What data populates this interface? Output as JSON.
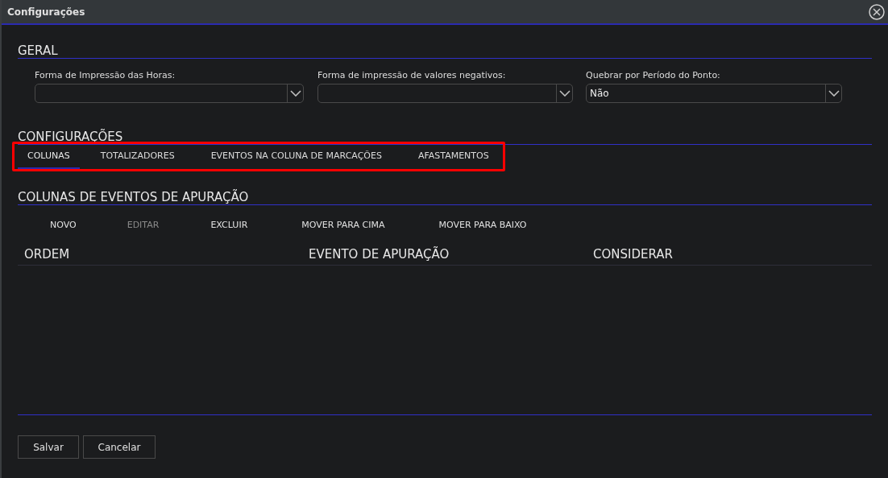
{
  "window": {
    "title": "Configurações"
  },
  "sections": [
    {
      "title": "GERAL"
    },
    {
      "title": "CONFIGURAÇÕES"
    },
    {
      "title": "COLUNAS DE EVENTOS DE APURAÇÃO"
    }
  ],
  "fields": [
    {
      "label": "Forma de Impressão das Horas:"
    },
    {
      "label": "Forma de impressão de valores negativos:"
    },
    {
      "label": "Quebrar por Período do Ponto:",
      "value": "Não"
    }
  ],
  "tabs": [
    {
      "label": "COLUNAS",
      "selected": true
    },
    {
      "label": "TOTALIZADORES",
      "selected": false
    },
    {
      "label": "EVENTOS NA COLUNA DE MARCAÇÕES",
      "selected": false
    },
    {
      "label": "AFASTAMENTOS",
      "selected": false
    }
  ],
  "tabs_highlighted": true,
  "toolbar": [
    {
      "label": "NOVO",
      "disabled": false
    },
    {
      "label": "EDITAR",
      "disabled": true
    },
    {
      "label": "EXCLUIR",
      "disabled": false
    },
    {
      "label": "MOVER PARA CIMA",
      "disabled": false
    },
    {
      "label": "MOVER PARA BAIXO",
      "disabled": false
    }
  ],
  "table": {
    "columns": [
      "ORDEM",
      "EVENTO DE APURAÇÃO",
      "CONSIDERAR"
    ]
  },
  "buttons": [
    "Salvar",
    "Cancelar"
  ]
}
